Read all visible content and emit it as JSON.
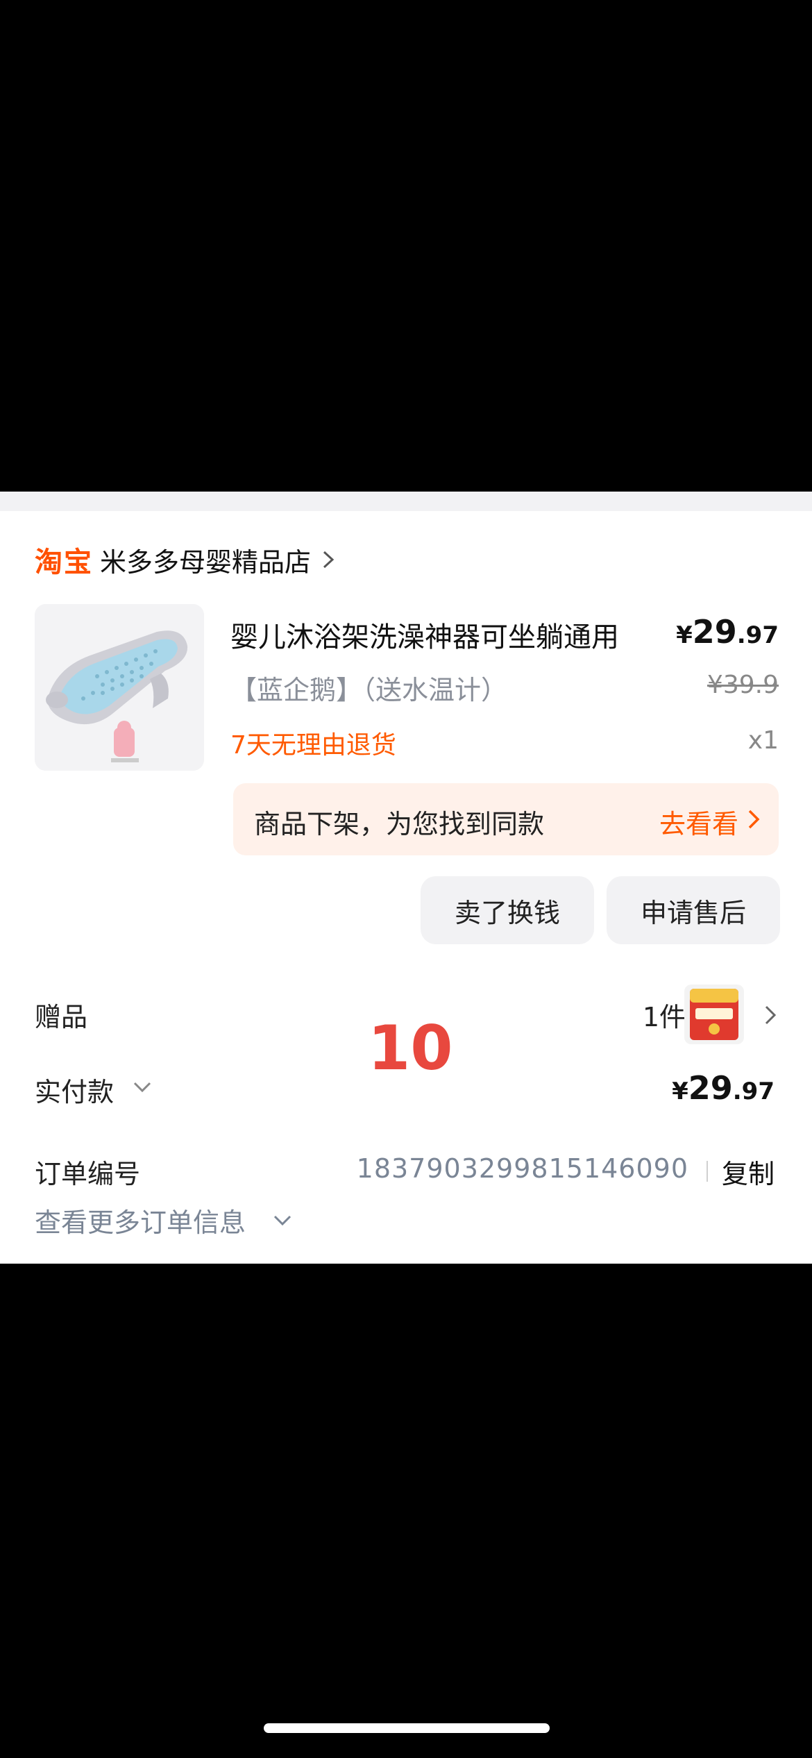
{
  "shop": {
    "logo": "淘宝",
    "name": "米多多母婴精品店"
  },
  "product": {
    "title": "婴儿沐浴架洗澡神器可坐躺通用",
    "spec": "【蓝企鹅】（送水温计）",
    "return_policy": "7天无理由退货",
    "price": {
      "currency": "¥",
      "int": "29",
      "dec": ".97"
    },
    "original_price": "¥39.9",
    "quantity": "x1"
  },
  "notice": {
    "text": "商品下架，为您找到同款",
    "link": "去看看"
  },
  "actions": {
    "sell": "卖了换钱",
    "after_sales": "申请售后"
  },
  "gift": {
    "label": "赠品",
    "count": "1件"
  },
  "overlay_number": "10",
  "payment": {
    "label": "实付款",
    "currency": "¥",
    "int": "29",
    "dec": ".97"
  },
  "order": {
    "label": "订单编号",
    "number": "1837903299815146090",
    "copy": "复制",
    "more": "查看更多订单信息"
  },
  "colors": {
    "accent": "#ff5000",
    "notice_bg": "#fff1ea"
  }
}
